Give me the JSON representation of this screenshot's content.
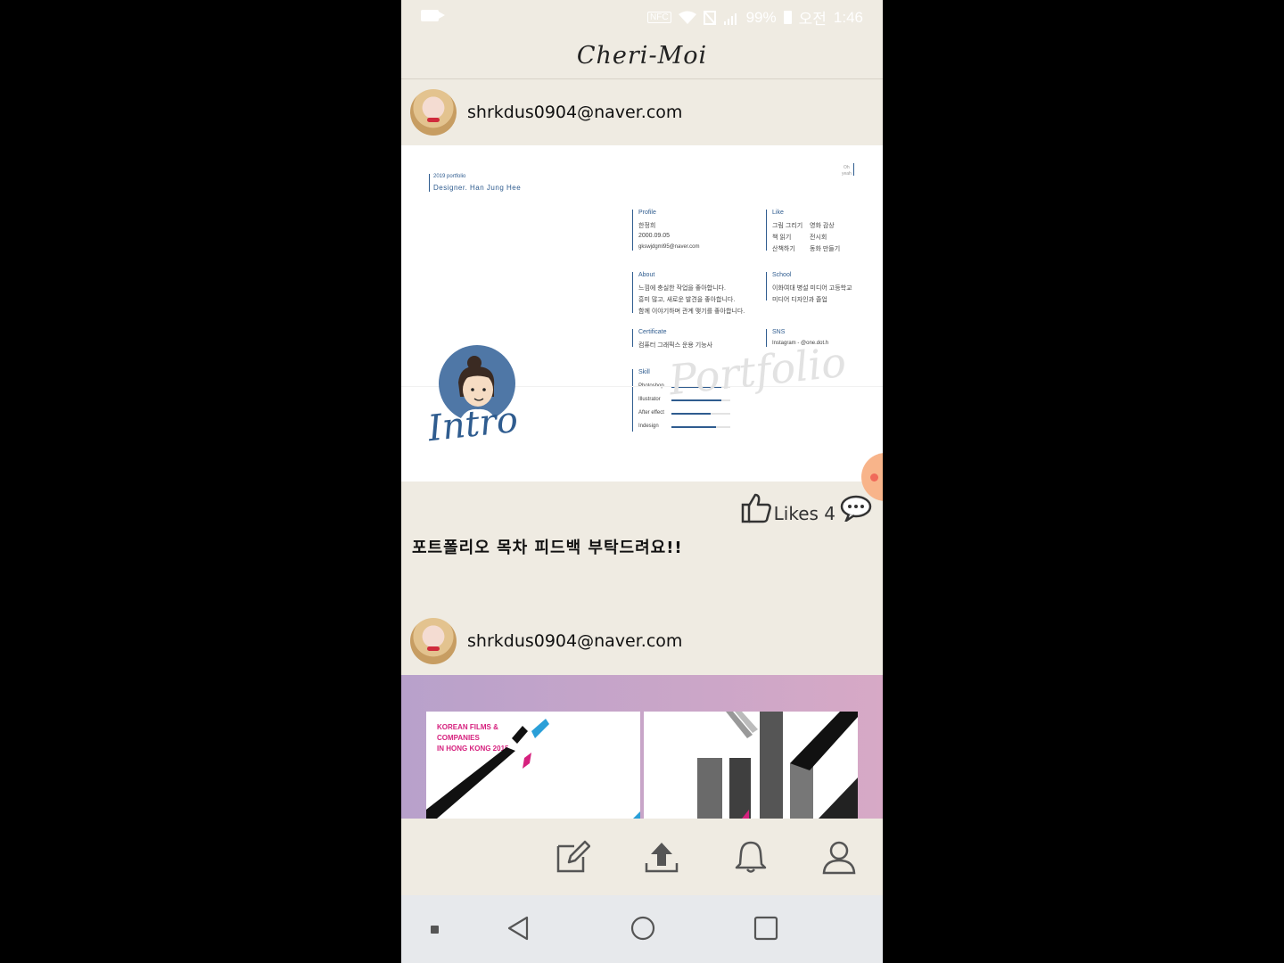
{
  "status_bar": {
    "battery": "99%",
    "am_pm": "오전",
    "time": "1:46",
    "nfc": "NFC"
  },
  "app": {
    "title": "Cheri-Moi"
  },
  "posts": [
    {
      "username": "shrkdus0904@naver.com",
      "card": {
        "top_left_small": "2019 portfolio",
        "designer": "Designer. Han Jung Hee",
        "top_right_1": "Oh",
        "top_right_2": "yeah",
        "profile": {
          "heading": "Profile",
          "lines": [
            "한정희",
            "2000.09.05",
            "gkswjdgml95@naver.com"
          ]
        },
        "like": {
          "heading": "Like",
          "col1": [
            "그림 그리기",
            "책 읽기",
            "산책하기"
          ],
          "col2": [
            "영화 감상",
            "전시회",
            "동화 만들기"
          ]
        },
        "about": {
          "heading": "About",
          "lines": [
            "느낌에 충실한 작업을 좋아합니다.",
            "흥미 많고, 새로운 발견을 좋아합니다.",
            "함께 이야기하며 관계 맺기를 좋아합니다."
          ]
        },
        "school": {
          "heading": "School",
          "lines": [
            "이화여대 병설 미디어 고등학교",
            "미디어 디자인과 졸업"
          ]
        },
        "certificate": {
          "heading": "Certificate",
          "lines": [
            "컴퓨터 그래픽스 운용 기능사"
          ]
        },
        "sns": {
          "heading": "SNS",
          "lines": [
            "Instagram - @one.dot.h"
          ]
        },
        "skill": {
          "heading": "Skill",
          "items": [
            {
              "name": "Photoshop",
              "level": 0.85
            },
            {
              "name": "Illustrator",
              "level": 0.85
            },
            {
              "name": "After effect",
              "level": 0.67
            },
            {
              "name": "Indesign",
              "level": 0.76
            }
          ]
        },
        "script_intro": "Intro",
        "script_portfolio": "Portfolio"
      },
      "likes_label": "Likes 4",
      "text": "포트폴리오 목차 피드백 부탁드려요!!"
    },
    {
      "username": "shrkdus0904@naver.com",
      "card": {
        "title_lines": [
          "KOREAN FILMS &",
          "COMPANIES",
          "IN HONG KONG 2015"
        ]
      }
    }
  ],
  "bottom_nav": [
    "write-icon",
    "upload-icon",
    "bell-icon",
    "profile-icon"
  ],
  "colors": {
    "background": "#efebe2",
    "accent": "#2f5c8f",
    "magenta": "#d6217e"
  }
}
